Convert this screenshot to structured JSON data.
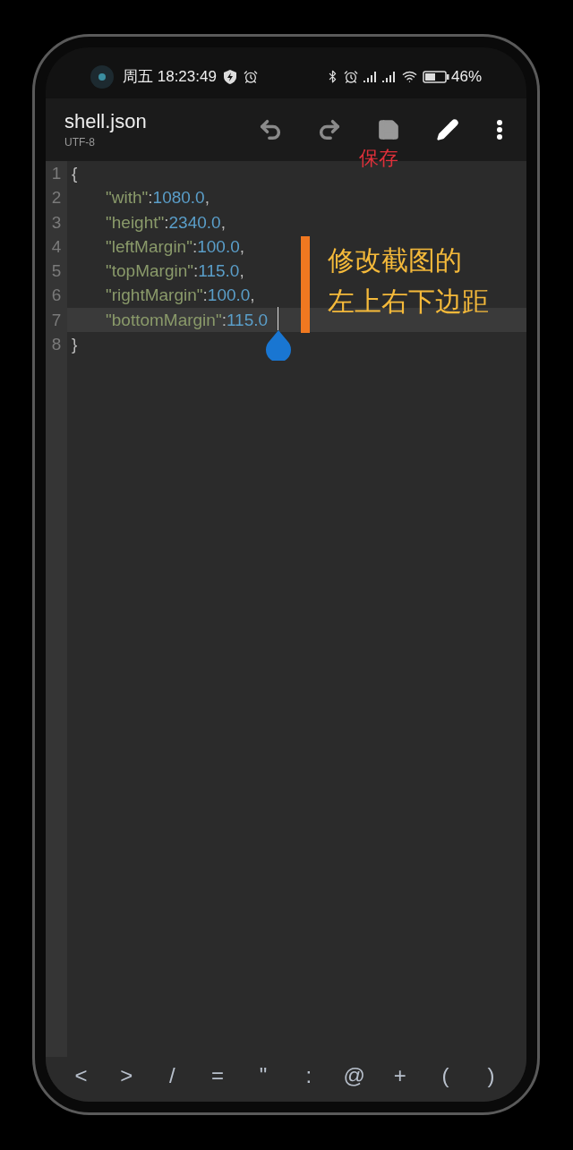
{
  "status_bar": {
    "day_time": "周五 18:23:49",
    "battery": "46%"
  },
  "toolbar": {
    "title": "shell.json",
    "encoding": "UTF-8",
    "save_label": "保存"
  },
  "editor": {
    "lines": [
      {
        "number": "1",
        "kind": "brace",
        "text": "{",
        "current": false
      },
      {
        "number": "2",
        "kind": "pair",
        "key": "\"with\"",
        "colon": ":",
        "value": "1080.0",
        "comma": ",",
        "current": false
      },
      {
        "number": "3",
        "kind": "pair",
        "key": "\"height\"",
        "colon": ":",
        "value": "2340.0",
        "comma": ",",
        "current": false
      },
      {
        "number": "4",
        "kind": "pair",
        "key": "\"leftMargin\"",
        "colon": ":",
        "value": "100.0",
        "comma": ",",
        "current": false
      },
      {
        "number": "5",
        "kind": "pair",
        "key": "\"topMargin\"",
        "colon": ":",
        "value": "115.0",
        "comma": ",",
        "current": false
      },
      {
        "number": "6",
        "kind": "pair",
        "key": "\"rightMargin\"",
        "colon": ":",
        "value": "100.0",
        "comma": ",",
        "current": false
      },
      {
        "number": "7",
        "kind": "pair",
        "key": "\"bottomMargin\"",
        "colon": ":",
        "value": "115.0",
        "current": true
      },
      {
        "number": "8",
        "kind": "brace",
        "text": "}",
        "current": false
      }
    ]
  },
  "annotation": {
    "lines": [
      "修改截图的",
      "左上右下边距"
    ]
  },
  "symbol_keys": [
    "<",
    ">",
    "/",
    "=",
    "\"",
    ":",
    "@",
    "+",
    "(",
    ")"
  ]
}
